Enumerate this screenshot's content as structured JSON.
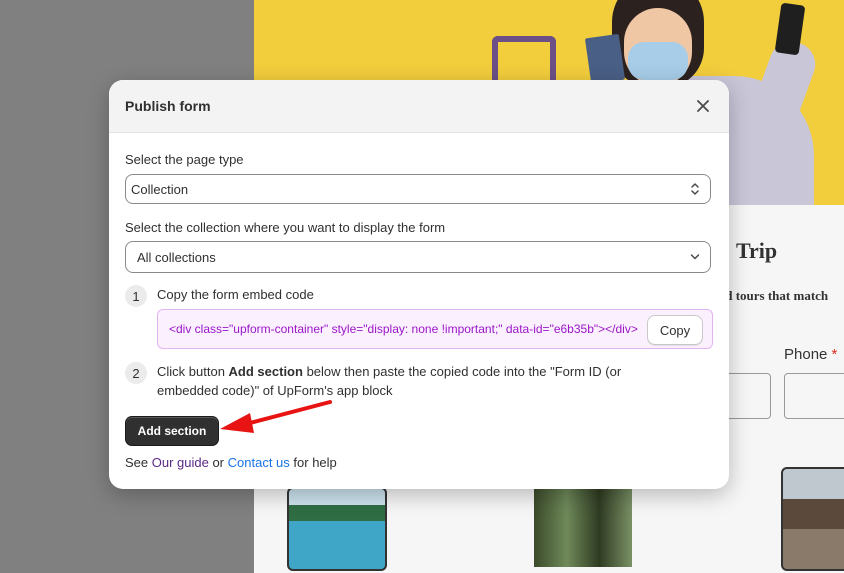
{
  "background": {
    "trip_title_fragment": "Trip",
    "subtitle_fragment": "nd tours that match",
    "phone_label": "Phone",
    "required_mark": "*"
  },
  "modal": {
    "title": "Publish form",
    "close_icon": "close-icon",
    "page_type": {
      "label": "Select the page type",
      "value": "Collection",
      "icon": "select-updown-icon"
    },
    "collection": {
      "label": "Select the collection where you want to display the form",
      "value": "All collections",
      "icon": "chevron-down-icon"
    },
    "step1": {
      "number": "1",
      "text": "Copy the form embed code",
      "code": "<div class=\"upform-container\" style=\"display: none !important;\" data-id=\"e6b35b\"></div>",
      "copy_label": "Copy"
    },
    "step2": {
      "number": "2",
      "text_before": "Click button ",
      "text_bold": "Add section",
      "text_after": " below then paste the copied code into the \"Form ID (or embedded code)\" of UpForm's app block"
    },
    "add_section_label": "Add section",
    "footer": {
      "see": "See ",
      "guide_link": "Our guide",
      "or": " or ",
      "contact_link": "Contact us",
      "help": " for help"
    }
  },
  "colors": {
    "hero_bg": "#f2cd3c",
    "code_text": "#9b16c9",
    "code_border": "#e4b3f2",
    "annotation_arrow": "#e81313",
    "link_guide": "#5b2a86",
    "link_contact": "#1a73e8"
  }
}
